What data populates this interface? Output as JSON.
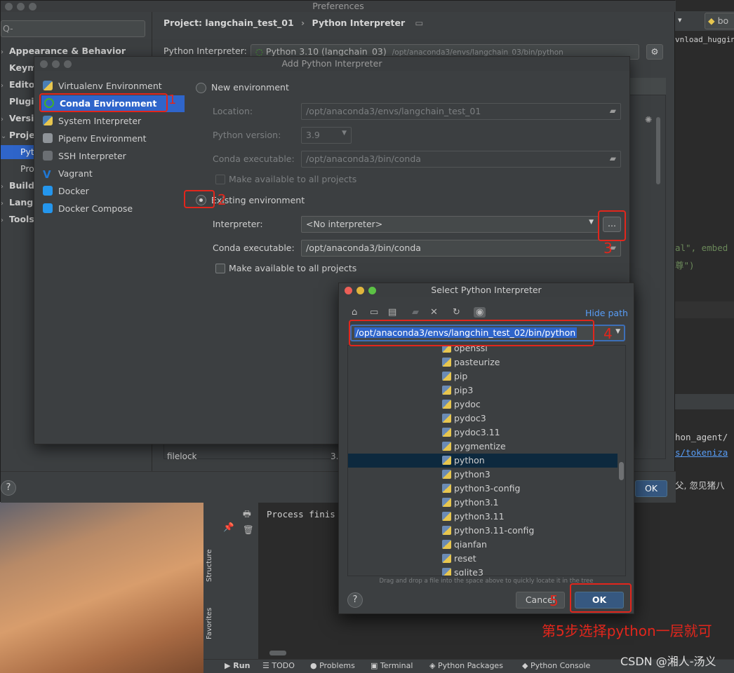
{
  "preferences": {
    "title": "Preferences",
    "search_placeholder": "Q-",
    "sidebar": [
      {
        "label": "Appearance & Behavior",
        "chevron": true
      },
      {
        "label": "Keym",
        "chevron": false
      },
      {
        "label": "Editor",
        "chevron": true
      },
      {
        "label": "Plugi",
        "chevron": false
      },
      {
        "label": "Versi",
        "chevron": true
      },
      {
        "label": "Proje",
        "chevron": true
      },
      {
        "label": "Pyth",
        "selected": true
      },
      {
        "label": "Pro",
        "chevron": false
      },
      {
        "label": "Build,",
        "chevron": true
      },
      {
        "label": "Langu",
        "chevron": true
      },
      {
        "label": "Tools",
        "chevron": true
      }
    ],
    "breadcrumb_project": "Project: langchain_test_01",
    "breadcrumb_sep": "›",
    "breadcrumb_page": "Python Interpreter",
    "interpreter_label": "Python Interpreter:",
    "interpreter_value": "Python 3.10 (langchain_03)",
    "interpreter_path": "/opt/anaconda3/envs/langchain_03/bin/python",
    "package_row_name": "filelock",
    "package_row_version": "3.",
    "ok_label": "OK",
    "help": "?"
  },
  "add_interpreter": {
    "title": "Add Python Interpreter",
    "env_types": [
      {
        "label": "Virtualenv Environment",
        "icon": "python-icon",
        "color": "#4a7fb5"
      },
      {
        "label": "Conda Environment",
        "icon": "conda-icon",
        "color": "#42b029",
        "selected": true
      },
      {
        "label": "System Interpreter",
        "icon": "python-icon",
        "color": "#4a7fb5"
      },
      {
        "label": "Pipenv Environment",
        "icon": "pipenv-icon",
        "color": "#8f9499"
      },
      {
        "label": "SSH Interpreter",
        "icon": "ssh-icon",
        "color": "#8f9499"
      },
      {
        "label": "Vagrant",
        "icon": "vagrant-icon",
        "color": "#1f77d4"
      },
      {
        "label": "Docker",
        "icon": "docker-icon",
        "color": "#2496ed"
      },
      {
        "label": "Docker Compose",
        "icon": "docker-compose-icon",
        "color": "#2496ed"
      }
    ],
    "new_env_label": "New environment",
    "location_label": "Location:",
    "location_value": "/opt/anaconda3/envs/langchain_test_01",
    "python_version_label": "Python version:",
    "python_version_value": "3.9",
    "conda_exec_label": "Conda executable:",
    "conda_exec_value": "/opt/anaconda3/bin/conda",
    "make_available_label": "Make available to all projects",
    "existing_env_label": "Existing environment",
    "interpreter_label": "Interpreter:",
    "interpreter_value": "<No interpreter>",
    "browse_label": "...",
    "conda_exec2_label": "Conda executable:",
    "conda_exec2_value": "/opt/anaconda3/bin/conda",
    "make_available2_label": "Make available to all projects"
  },
  "select_interpreter": {
    "title": "Select Python Interpreter",
    "hide_path": "Hide path",
    "path_value": "/opt/anaconda3/envs/langchin_test_02/bin/python",
    "files": [
      "openssl",
      "pasteurize",
      "pip",
      "pip3",
      "pydoc",
      "pydoc3",
      "pydoc3.11",
      "pygmentize",
      "python",
      "python3",
      "python3-config",
      "python3.1",
      "python3.11",
      "python3.11-config",
      "qianfan",
      "reset",
      "sqlite3"
    ],
    "selected_file": "python",
    "dnd_hint": "Drag and drop a file into the space above to quickly locate it in the tree",
    "cancel_label": "Cancel",
    "ok_label": "OK",
    "help": "?"
  },
  "annotations": {
    "n1": "1",
    "n2": "2",
    "n3": "3",
    "n4": "4",
    "n5": "5",
    "note": "第5步选择python一层就可",
    "watermark": "CSDN @湘人-汤义"
  },
  "ide": {
    "run_output": "Process finis",
    "right_code_1": "al\", embed",
    "right_code_2": "尊\")",
    "right_code_3": "hon_agent/",
    "right_code_4": "s/tokeniza",
    "right_text_5": "父, 忽见猪八",
    "right_tab": "bo",
    "right_download": "vnload_hugging",
    "structure_label": "Structure",
    "favorites_label": "Favorites",
    "status_items": [
      "Run",
      "TODO",
      "Problems",
      "Terminal",
      "Python Packages",
      "Python Console"
    ]
  }
}
